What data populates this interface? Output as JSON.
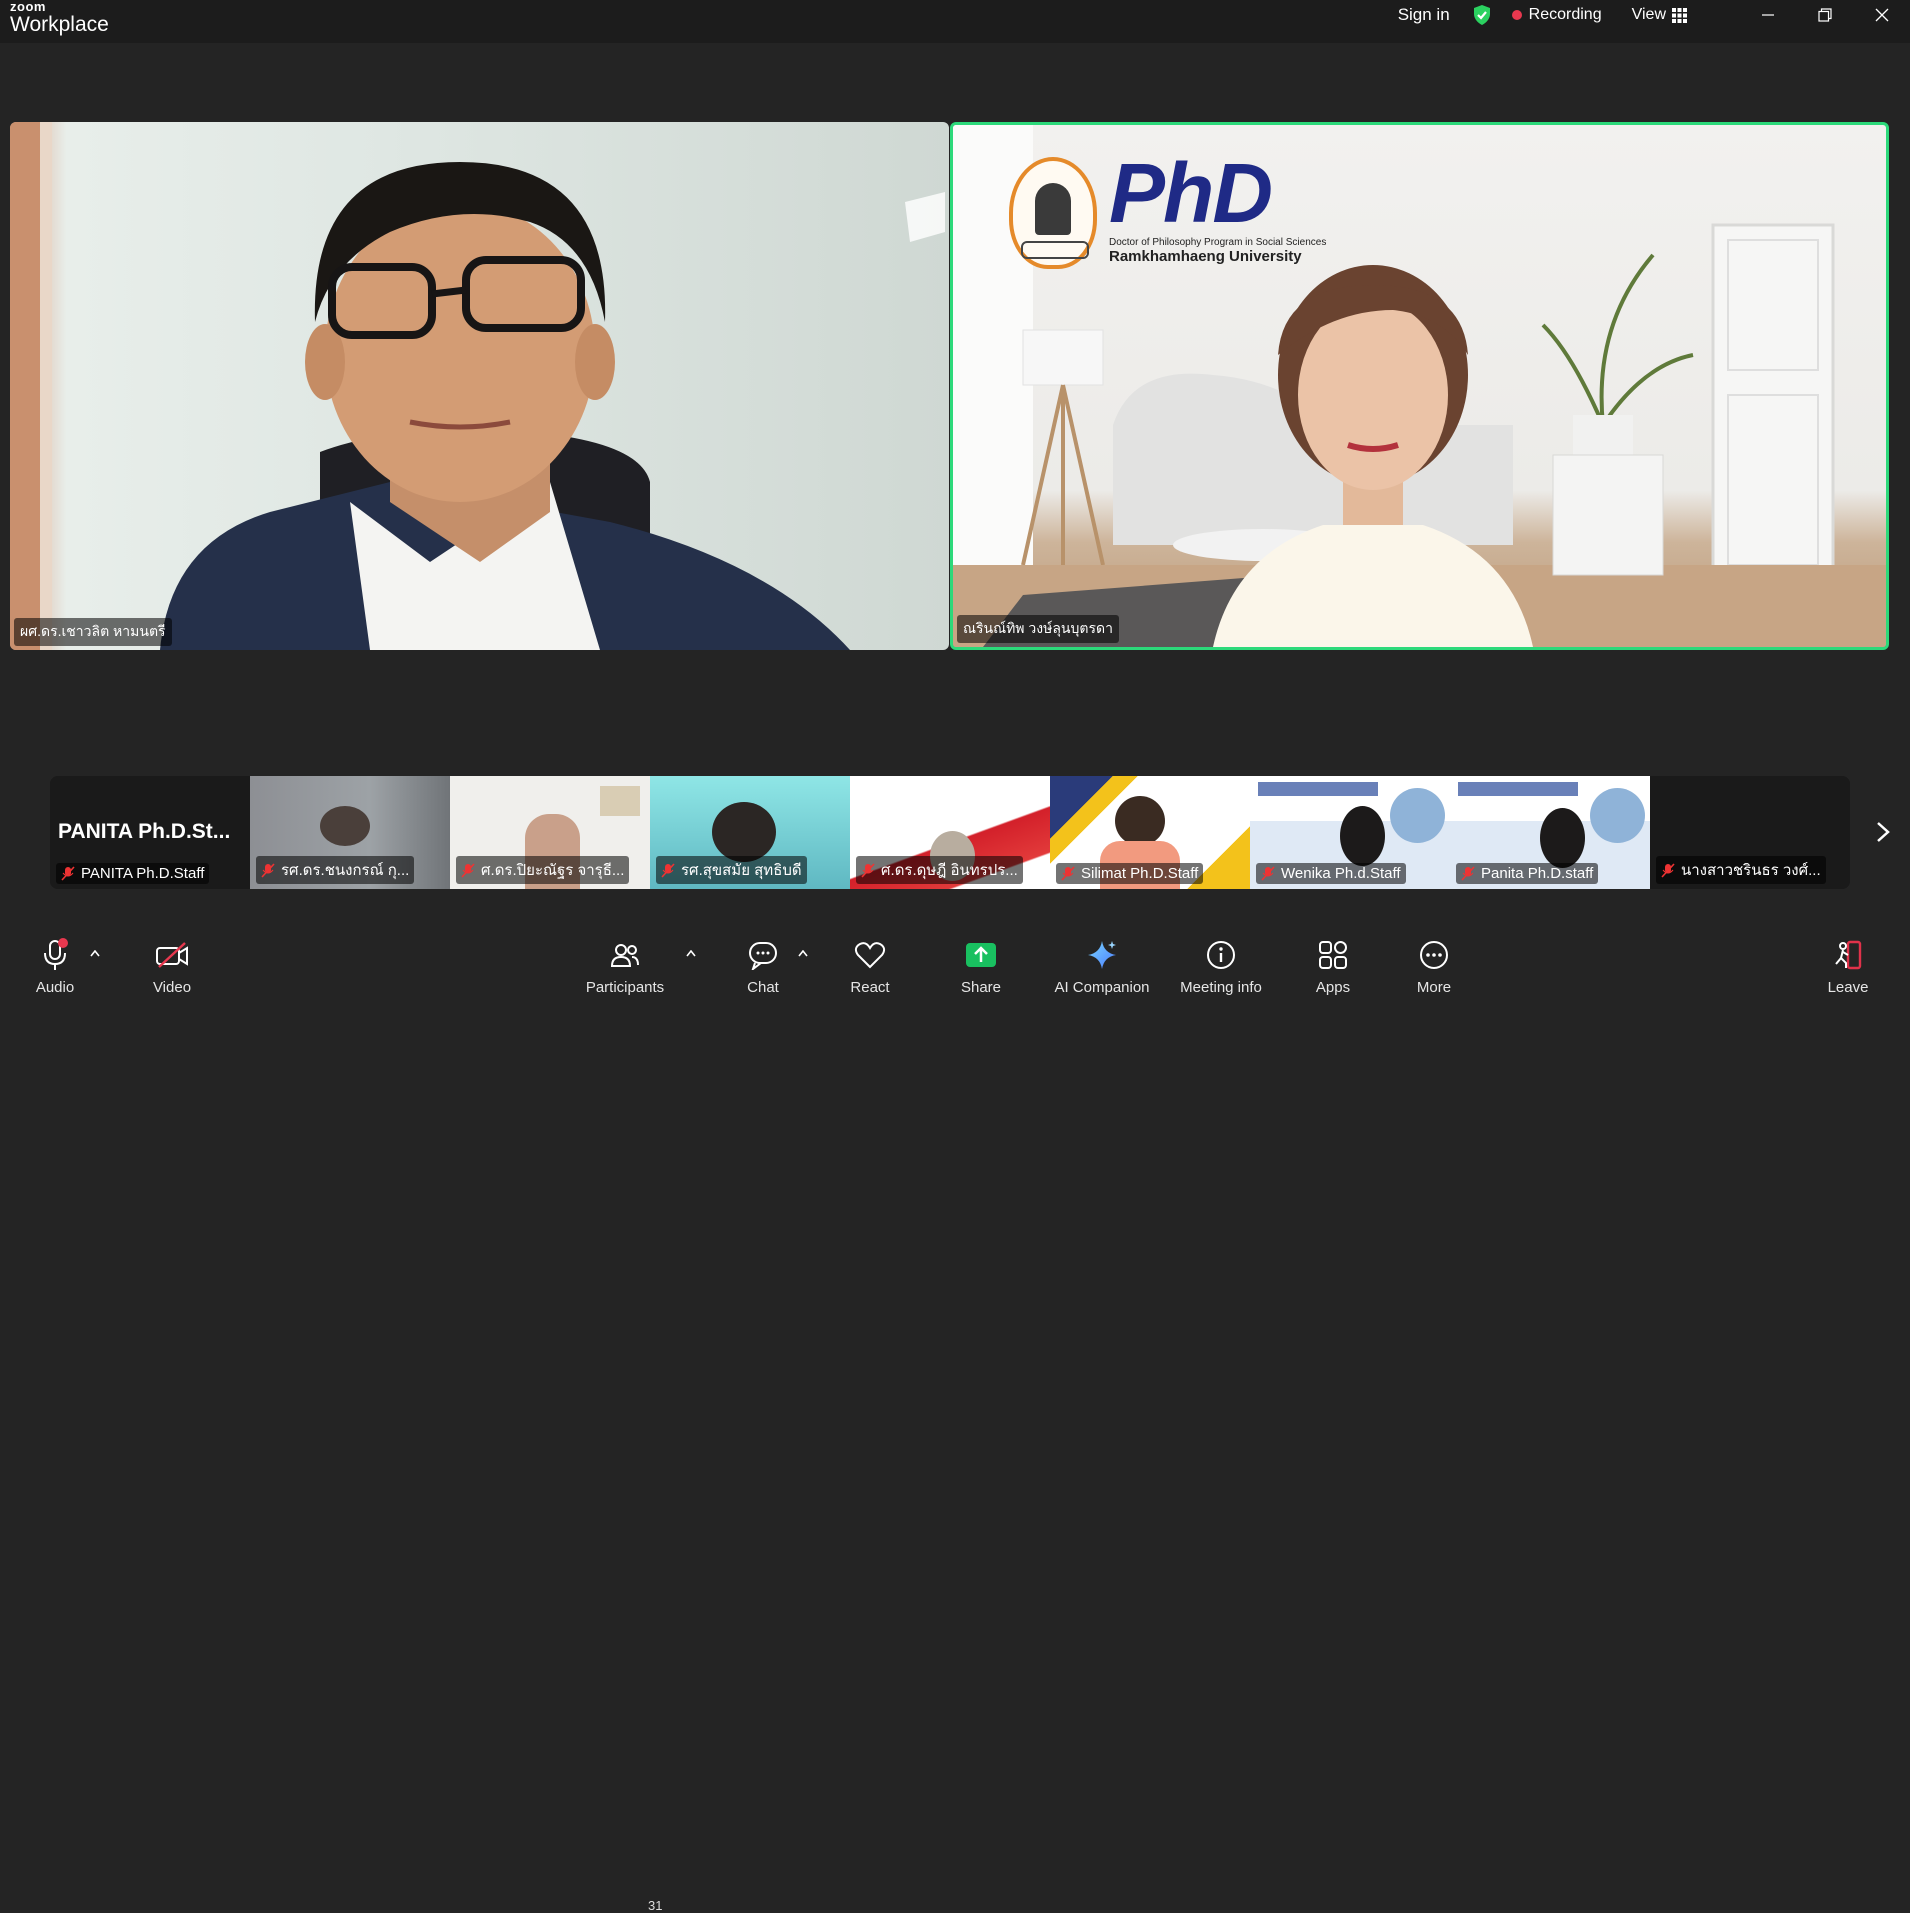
{
  "app": {
    "brand_small": "zoom",
    "brand_large": "Workplace"
  },
  "titlebar": {
    "signin": "Sign in",
    "recording": "Recording",
    "view": "View"
  },
  "speakers": [
    {
      "name": "ผศ.ดร.เชาวลิต  หามนตรี"
    },
    {
      "name": "ณรินณ์ทิพ วงษ์ลุนบุตรดา"
    }
  ],
  "background": {
    "logo_main": "PhD",
    "logo_sub": "Doctor of Philosophy Program in Social Sciences",
    "logo_uni": "Ramkhamhaeng University"
  },
  "strip": {
    "big_name": "PANITA  Ph.D.St...",
    "participants": [
      "PANITA Ph.D.Staff",
      "รศ.ดร.ชนงกรณ์  กุ...",
      "ศ.ดร.ปิยะณัฐร  จารุธี...",
      "รศ.สุขสมัย สุทธิบดี",
      "ศ.ดร.ดุษฎี  อินทรปร...",
      "Silimat Ph.D.Staff",
      "Wenika Ph.d.Staff",
      "Panita Ph.D.staff",
      "นางสาวชรินธร วงศ์..."
    ]
  },
  "toolbar": {
    "audio": "Audio",
    "video": "Video",
    "participants": "Participants",
    "participants_count": "31",
    "chat": "Chat",
    "react": "React",
    "share": "Share",
    "ai": "AI Companion",
    "meeting_info": "Meeting info",
    "apps": "Apps",
    "more": "More",
    "leave": "Leave"
  },
  "colors": {
    "active_speaker": "#2cd97a",
    "share": "#19c060",
    "recording": "#e8384f",
    "leave": "#e0324a"
  }
}
